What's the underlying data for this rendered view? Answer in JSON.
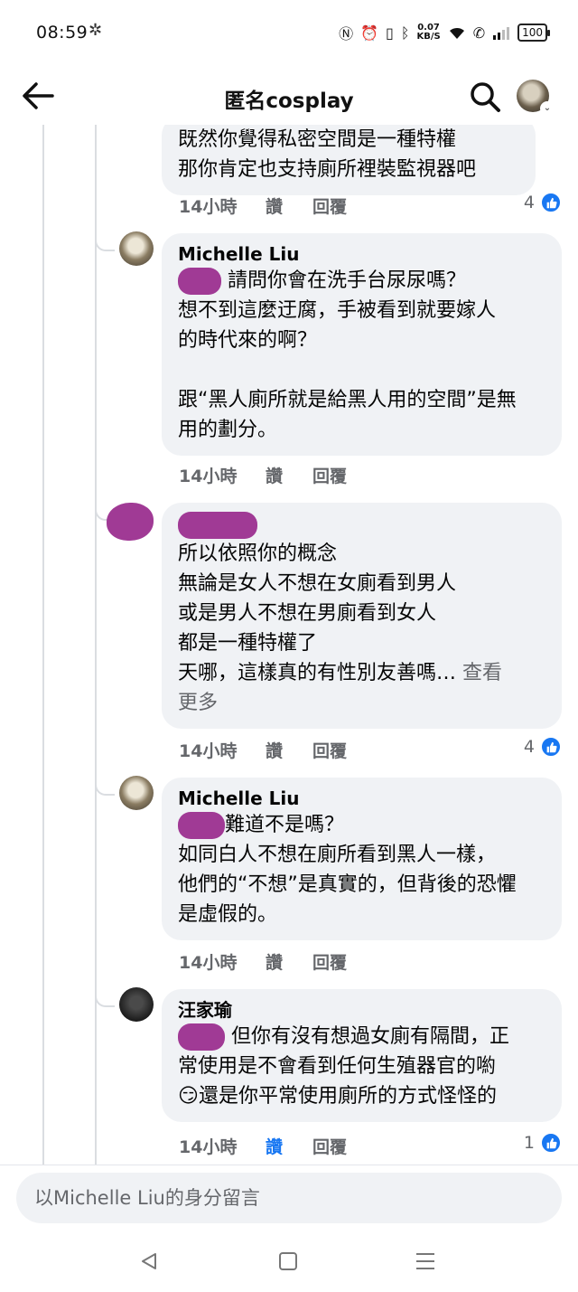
{
  "status": {
    "time": "08:59",
    "network_speed_value": "0.07",
    "network_speed_unit": "KB/S",
    "battery": "100"
  },
  "header": {
    "title": "匿名cosplay"
  },
  "comments": [
    {
      "text": "既然你覺得私密空間是一種特權\n那你肯定也支持廁所裡裝監視器吧",
      "time": "14小時",
      "like_label": "讚",
      "reply_label": "回覆",
      "reaction_count": "4"
    },
    {
      "author": "Michelle Liu",
      "text_first": "請問你會在洗手台尿尿嗎？",
      "text": "想不到這麼迂腐，手被看到就要嫁人\n的時代來的啊？\n\n跟“黑人廁所就是給黑人用的空間”是無\n用的劃分。",
      "time": "14小時",
      "like_label": "讚",
      "reply_label": "回覆"
    },
    {
      "text": "所以依照你的概念\n無論是女人不想在女廁看到男人\n或是男人不想在男廁看到女人\n都是一種特權了\n天哪，這樣真的有性別友善嗎…",
      "see_more": "查看\n更多",
      "time": "14小時",
      "like_label": "讚",
      "reply_label": "回覆",
      "reaction_count": "4"
    },
    {
      "author": "Michelle Liu",
      "text_first": "難道不是嗎？",
      "text": "如同白人不想在廁所看到黑人一樣，\n他們的“不想”是真實的，但背後的恐懼\n是虛假的。",
      "time": "14小時",
      "like_label": "讚",
      "reply_label": "回覆"
    },
    {
      "author": "汪家瑜",
      "text_first": "但你有沒有想過女廁有隔間，正",
      "text": "常使用是不會看到任何生殖器官的喲",
      "emoji": "😏",
      "text_last": "還是你平常使用廁所的方式怪怪的",
      "time": "14小時",
      "like_label": "讚",
      "reply_label": "回覆",
      "reaction_count": "1"
    }
  ],
  "composer": {
    "placeholder": "以Michelle Liu的身分留言"
  },
  "colors": {
    "accent": "#1877f2",
    "bubble": "#f0f2f5",
    "redaction": "#a03a95",
    "meta_text": "#65676b"
  }
}
